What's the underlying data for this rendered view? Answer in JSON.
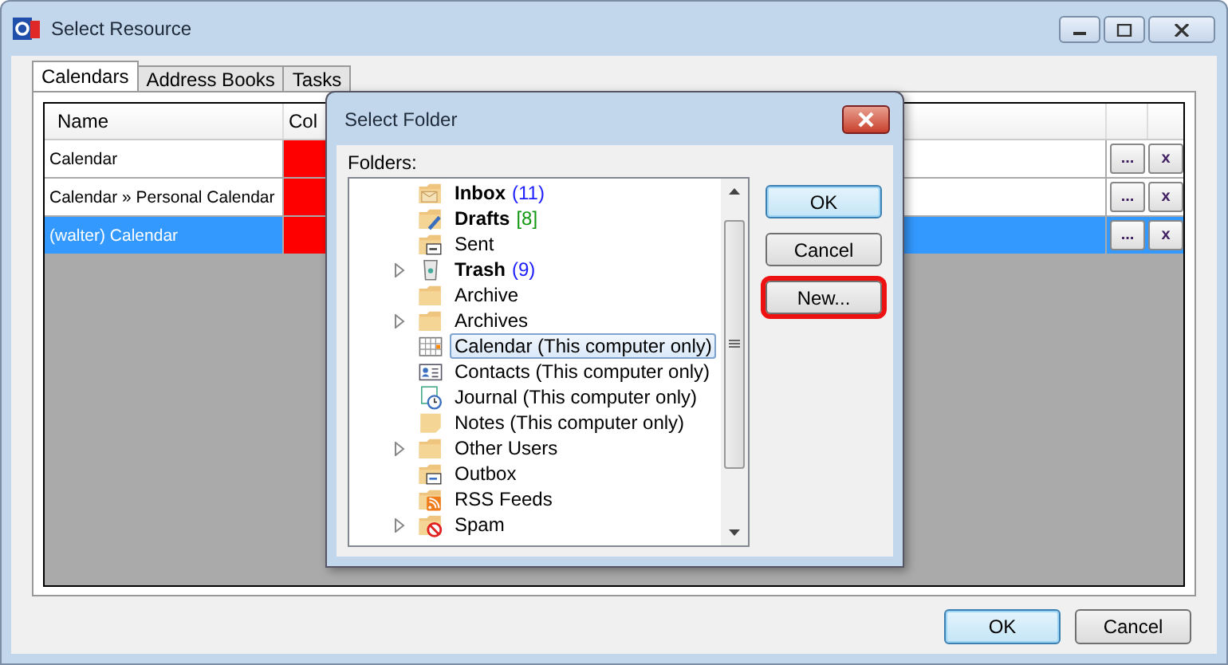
{
  "window": {
    "title": "Select Resource"
  },
  "tabs": [
    {
      "label": "Calendars",
      "selected": true
    },
    {
      "label": "Address Books",
      "selected": false
    },
    {
      "label": "Tasks",
      "selected": false
    }
  ],
  "table": {
    "columns": [
      "Name",
      "Col"
    ],
    "rows": [
      {
        "name": "Calendar",
        "color": "#ff0000",
        "selected": false,
        "edit": "...",
        "remove": "x"
      },
      {
        "name": "Calendar » Personal Calendar",
        "color": "#ff0000",
        "selected": false,
        "edit": "...",
        "remove": "x"
      },
      {
        "name": "(walter) Calendar",
        "color": "#ff0000",
        "selected": true,
        "edit": "...",
        "remove": "x"
      }
    ]
  },
  "dialog": {
    "title": "Select Folder",
    "folders_label": "Folders:",
    "folders": [
      {
        "label": "Inbox",
        "count": "(11)",
        "color": "#2020ff",
        "bold": true,
        "expandable": false,
        "selected": false,
        "kind": "mail"
      },
      {
        "label": "Drafts",
        "count": "[8]",
        "color": "#119911",
        "bold": true,
        "expandable": false,
        "selected": false,
        "kind": "drafts"
      },
      {
        "label": "Sent",
        "bold": false,
        "expandable": false,
        "selected": false,
        "kind": "sent"
      },
      {
        "label": "Trash",
        "count": "(9)",
        "color": "#2020ff",
        "bold": true,
        "expandable": true,
        "selected": false,
        "kind": "trash"
      },
      {
        "label": "Archive",
        "bold": false,
        "expandable": false,
        "selected": false,
        "kind": "folder"
      },
      {
        "label": "Archives",
        "bold": false,
        "expandable": true,
        "selected": false,
        "kind": "folder"
      },
      {
        "label": "Calendar (This computer only)",
        "bold": false,
        "expandable": false,
        "selected": true,
        "kind": "calendar"
      },
      {
        "label": "Contacts (This computer only)",
        "bold": false,
        "expandable": false,
        "selected": false,
        "kind": "contacts"
      },
      {
        "label": "Journal (This computer only)",
        "bold": false,
        "expandable": false,
        "selected": false,
        "kind": "journal"
      },
      {
        "label": "Notes (This computer only)",
        "bold": false,
        "expandable": false,
        "selected": false,
        "kind": "notes"
      },
      {
        "label": "Other Users",
        "bold": false,
        "expandable": true,
        "selected": false,
        "kind": "folder"
      },
      {
        "label": "Outbox",
        "bold": false,
        "expandable": false,
        "selected": false,
        "kind": "outbox"
      },
      {
        "label": "RSS Feeds",
        "bold": false,
        "expandable": false,
        "selected": false,
        "kind": "rss"
      },
      {
        "label": "Spam",
        "bold": false,
        "expandable": true,
        "selected": false,
        "kind": "spam"
      }
    ],
    "buttons": [
      {
        "label": "OK",
        "default": true,
        "highlighted": false
      },
      {
        "label": "Cancel",
        "default": false,
        "highlighted": false
      },
      {
        "label": "New...",
        "default": false,
        "highlighted": true
      }
    ]
  },
  "buttons": [
    {
      "label": "OK",
      "default": true
    },
    {
      "label": "Cancel",
      "default": false
    }
  ]
}
